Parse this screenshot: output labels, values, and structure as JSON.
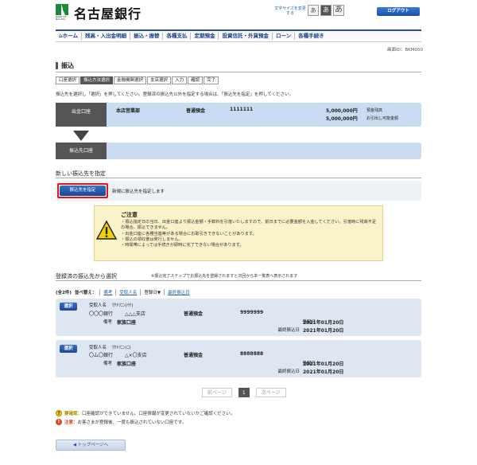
{
  "header": {
    "bank_name": "名古屋銀行",
    "logo_sub": "BANK OF NAGOYA",
    "font_size_label": "文字サイズを変更する",
    "font_small": "あ",
    "font_medium": "あ",
    "font_large": "あ",
    "logout": "ログアウト"
  },
  "nav": {
    "items": [
      "ホーム",
      "残高・入出金明細",
      "振込・振替",
      "各種支払",
      "定期預金",
      "投資信託・外貨預金",
      "ローン",
      "各種手続き"
    ]
  },
  "screen_id": "画面ID：BKM050",
  "page_title": "振込",
  "steps": [
    "口座選択",
    "振込方法選択",
    "金融機関選択",
    "支店選択",
    "入力",
    "確認",
    "完了"
  ],
  "instruction": "振込先を選択し「選択」を押してください。登録済の振込先以外を指定する場合は、「振込先を指定」を押してください。",
  "source_account": {
    "label": "出金口座",
    "branch": "本店営業部",
    "type": "普通預金",
    "number": "1111111",
    "balance": "5,000,000円",
    "balance_label": "預金残高",
    "available": "5,000,000円",
    "available_label": "お引出し可能金額"
  },
  "dest_label": "振込先口座",
  "new_section": {
    "title": "新しい振込先を指定",
    "button": "振込先を指定",
    "desc": "新規に振込先を指定します"
  },
  "notice": {
    "title": "ご注意",
    "items": [
      "振込指定日の当日、出金口座より振込金額・手数料を引落いたしますので、前日までに必要金額を入金してください。引落時に残高不足の場合、振込できません。",
      "出金口座に各種当座等がある場合にお取引きできないことがあります。",
      "振込の領収書は発行しません。",
      "時間帯によっては手続きが即時に完了できない場合があります。"
    ]
  },
  "registered": {
    "title": "登録済の振込先から選択",
    "note": "※振込完了ステップでお振込先を登録されますと次回から本一覧表へ表示されます",
    "count": "(全2件)",
    "sort_label": "並べ替え：",
    "sort_options": [
      "備考",
      "受取人名",
      "登録日▼",
      "最終振込日"
    ],
    "cards": [
      {
        "select": "選択",
        "recipient_label": "受取人名",
        "recipient": "ｳｹﾄﾘﾆﾝ(ｲﾁ)",
        "bank": "〇〇〇銀行",
        "branch": "△△△支店",
        "memo_label": "備考",
        "memo": "家族口座",
        "type": "普通預金",
        "number": "9999999",
        "reg_label": "登録日",
        "reg_date": "2021年01月20日",
        "last_label": "最終振込日",
        "last_date": "2021年01月20日"
      },
      {
        "select": "選択",
        "recipient_label": "受取人名",
        "recipient": "ｳｹﾄﾘﾆﾝ(ﾆ)",
        "bank": "〇ム〇銀行",
        "branch": "△×〇支店",
        "memo_label": "備考",
        "memo": "家族口座",
        "type": "普通預金",
        "number": "8888888",
        "reg_label": "登録日",
        "reg_date": "2021年01月20日",
        "last_label": "最終振込日",
        "last_date": "2021年01月20日"
      }
    ]
  },
  "pager": {
    "prev": "前ページ",
    "current": "1",
    "next": "次ページ"
  },
  "legend": [
    {
      "label": "要確認：",
      "text": "口座確認ができていません。口座情報が変更されていないかご確認ください。",
      "color": "#e0b000"
    },
    {
      "label": "注意：",
      "text": "お客さまが登録後、一度も振込されていない口座です。",
      "color": "#d94a1e"
    }
  ],
  "top_button": "トップページへ"
}
